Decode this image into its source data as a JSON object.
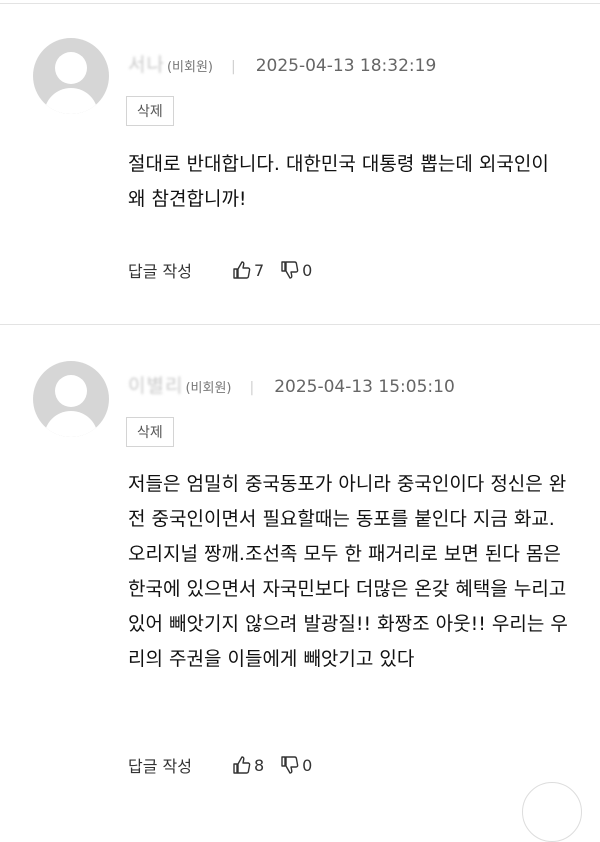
{
  "comments": [
    {
      "nickname": "서나",
      "member_label": "(비회원)",
      "separator": "|",
      "datetime": "2025-04-13 18:32:19",
      "delete_label": "삭제",
      "text": "절대로 반대합니다. 대한민국 대통령 뽑는데 외국인이 왜 참견합니까!",
      "reply_label": "답글 작성",
      "likes": "7",
      "dislikes": "0"
    },
    {
      "nickname": "이별리",
      "member_label": "(비회원)",
      "separator": "|",
      "datetime": "2025-04-13 15:05:10",
      "delete_label": "삭제",
      "text": "저들은 엄밀히 중국동포가 아니라 중국인이다 정신은 완전 중국인이면서 필요할때는 동포를 붙인다 지금 화교.오리지널 짱깨.조선족 모두 한 패거리로 보면 된다 몸은 한국에 있으면서 자국민보다 더많은 온갖 혜택을 누리고 있어 빼앗기지 않으려 발광질!! 화짱조 아웃!! 우리는 우리의 주권을 이들에게 빼앗기고 있다",
      "reply_label": "답글 작성",
      "likes": "8",
      "dislikes": "0"
    }
  ],
  "icons": {
    "avatar": "default-user-avatar-icon",
    "like": "thumbs-up-icon",
    "dislike": "thumbs-down-icon"
  }
}
